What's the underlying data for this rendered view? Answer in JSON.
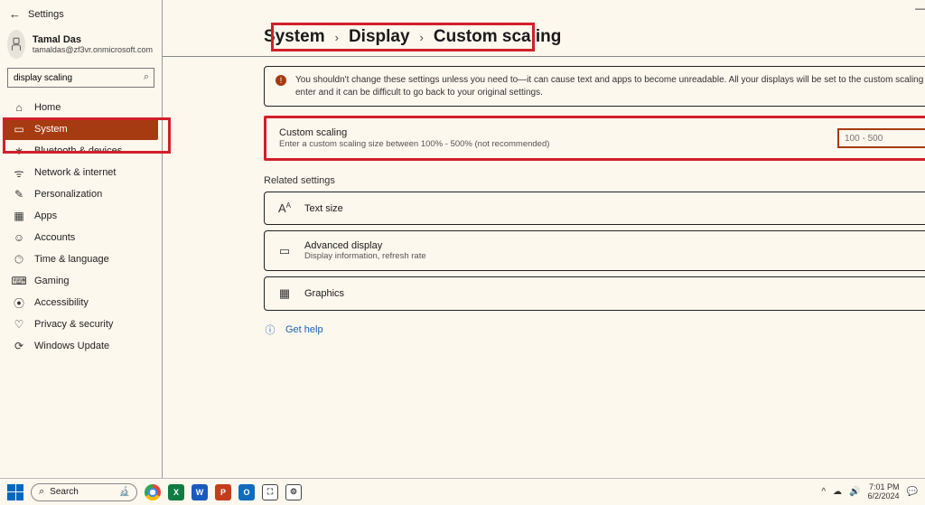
{
  "titlebar": {
    "title": "Settings"
  },
  "profile": {
    "name": "Tamal Das",
    "email": "tamaldas@zf3vr.onmicrosoft.com"
  },
  "search": {
    "value": "display scaling"
  },
  "sidebar": {
    "items": [
      {
        "label": "Home"
      },
      {
        "label": "System"
      },
      {
        "label": "Bluetooth & devices"
      },
      {
        "label": "Network & internet"
      },
      {
        "label": "Personalization"
      },
      {
        "label": "Apps"
      },
      {
        "label": "Accounts"
      },
      {
        "label": "Time & language"
      },
      {
        "label": "Gaming"
      },
      {
        "label": "Accessibility"
      },
      {
        "label": "Privacy & security"
      },
      {
        "label": "Windows Update"
      }
    ]
  },
  "breadcrumb": {
    "l1": "System",
    "l2": "Display",
    "l3": "Custom scaling"
  },
  "warning": {
    "text": "You shouldn't change these settings unless you need to—it can cause text and apps to become unreadable. All your displays will be set to the custom scaling size you enter and it can be difficult to go back to your original settings."
  },
  "scaling": {
    "title": "Custom scaling",
    "sub": "Enter a custom scaling size between 100% - 500% (not recommended)",
    "placeholder": "100 - 500"
  },
  "related": {
    "heading": "Related settings",
    "items": [
      {
        "title": "Text size",
        "sub": ""
      },
      {
        "title": "Advanced display",
        "sub": "Display information, refresh rate"
      },
      {
        "title": "Graphics",
        "sub": ""
      }
    ]
  },
  "help": {
    "label": "Get help"
  },
  "taskbar": {
    "search_placeholder": "Search",
    "time": "7:01 PM",
    "date": "6/2/2024"
  }
}
